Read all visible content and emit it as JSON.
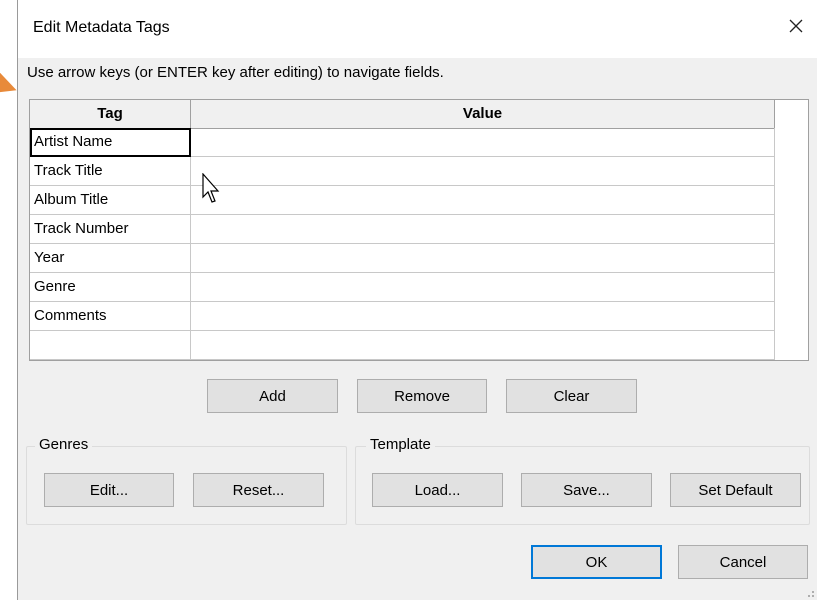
{
  "dialog": {
    "title": "Edit Metadata Tags",
    "instruction": "Use arrow keys (or ENTER key after editing) to navigate fields."
  },
  "grid": {
    "columns": [
      "Tag",
      "Value"
    ],
    "rows": [
      {
        "tag": "Artist Name",
        "value": ""
      },
      {
        "tag": "Track Title",
        "value": ""
      },
      {
        "tag": "Album Title",
        "value": ""
      },
      {
        "tag": "Track Number",
        "value": ""
      },
      {
        "tag": "Year",
        "value": ""
      },
      {
        "tag": "Genre",
        "value": ""
      },
      {
        "tag": "Comments",
        "value": ""
      },
      {
        "tag": "",
        "value": ""
      }
    ]
  },
  "row_buttons": {
    "add": "Add",
    "remove": "Remove",
    "clear": "Clear"
  },
  "genres": {
    "label": "Genres",
    "edit": "Edit...",
    "reset": "Reset..."
  },
  "template": {
    "label": "Template",
    "load": "Load...",
    "save": "Save...",
    "set_default": "Set Default"
  },
  "footer": {
    "ok": "OK",
    "cancel": "Cancel"
  },
  "colors": {
    "accent": "#0078d7",
    "marker": "#e88a3a"
  }
}
